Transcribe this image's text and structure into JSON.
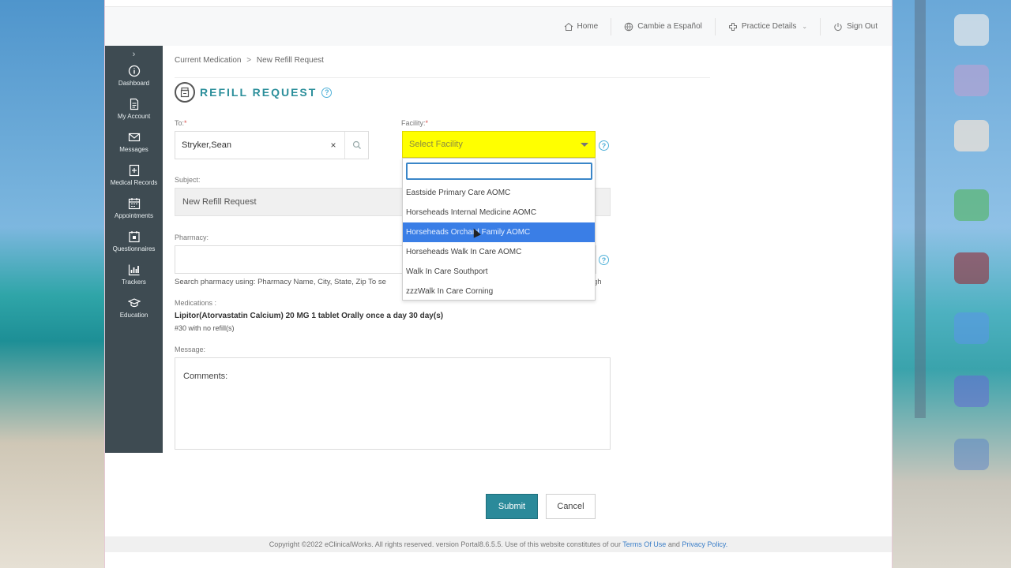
{
  "topnav": {
    "home": "Home",
    "language": "Cambie a Español",
    "practice": "Practice Details",
    "signout": "Sign Out"
  },
  "sidebar": {
    "toggle": "›",
    "items": [
      {
        "label": "Dashboard",
        "icon": "info-icon"
      },
      {
        "label": "My Account",
        "icon": "document-icon"
      },
      {
        "label": "Messages",
        "icon": "mail-icon"
      },
      {
        "label": "Medical Records",
        "icon": "records-icon"
      },
      {
        "label": "Appointments",
        "icon": "calendar-icon"
      },
      {
        "label": "Questionnaires",
        "icon": "questionnaire-icon"
      },
      {
        "label": "Trackers",
        "icon": "chart-icon"
      },
      {
        "label": "Education",
        "icon": "graduation-cap-icon"
      }
    ]
  },
  "breadcrumb": {
    "parent": "Current Medication",
    "separator": ">",
    "current": "New Refill Request"
  },
  "page": {
    "title": "REFILL REQUEST",
    "help": "?"
  },
  "form": {
    "to_label": "To:",
    "to_value": "Stryker,Sean",
    "clear": "×",
    "facility_label": "Facility:",
    "facility_placeholder": "Select Facility",
    "required_mark": "*",
    "subject_label": "Subject:",
    "subject_value": "New Refill Request",
    "pharmacy_label": "Pharmacy:",
    "pharmacy_hint": "Search pharmacy using: Pharmacy Name, City, State, Zip To se",
    "pharmacy_hint_tail": "gh",
    "medications_label": "Medications :",
    "medication_name": "Lipitor(Atorvastatin Calcium) 20 MG 1 tablet Orally once a day 30 day(s)",
    "medication_qty": "#30 with no refill(s)",
    "message_label": "Message:",
    "message_value": "Comments:"
  },
  "facility_dropdown": {
    "search_value": "",
    "options": [
      "Eastside Primary Care AOMC",
      "Horseheads Internal Medicine AOMC",
      "Horseheads Orchard Family AOMC",
      "Horseheads Walk In Care AOMC",
      "Walk In Care Southport",
      "zzzWalk In Care Corning"
    ],
    "highlighted_index": 2
  },
  "buttons": {
    "submit": "Submit",
    "cancel": "Cancel"
  },
  "footer": {
    "text": "Copyright ©2022 eClinicalWorks. All rights reserved. version Portal8.6.5.5.  Use of this website constitutes of our",
    "terms": "Terms Of Use",
    "and": "and",
    "privacy": "Privacy Policy."
  },
  "colors": {
    "accent": "#2c8f9b",
    "sidebar": "#3e4b52",
    "facility_highlight": "#ffff00",
    "option_active": "#3a7ee6"
  }
}
